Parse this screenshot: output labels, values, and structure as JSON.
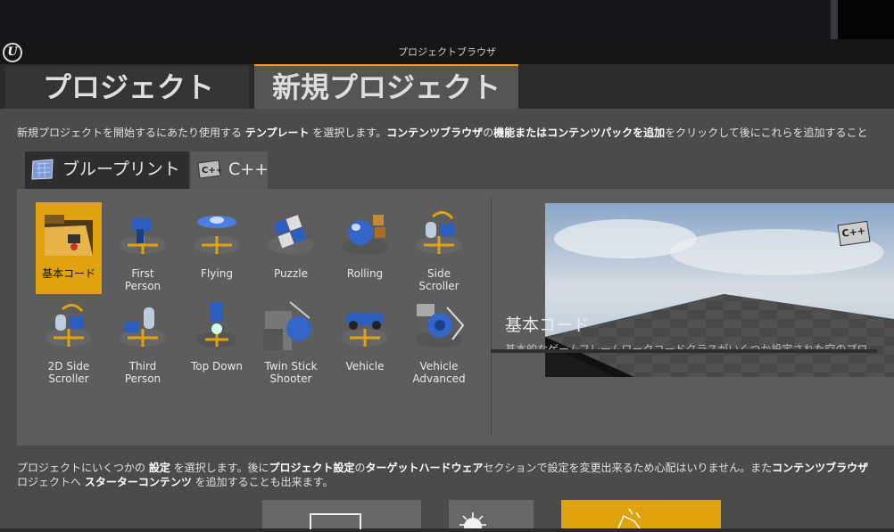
{
  "window": {
    "title": "プロジェクトブラウザ",
    "logo_text": "U"
  },
  "main_tabs": [
    {
      "label": "プロジェクト"
    },
    {
      "label": "新規プロジェクト"
    }
  ],
  "template_description": {
    "p1": "新規プロジェクトを開始するにあたり使用する ",
    "b1": "テンプレート",
    "p2": " を選択します。",
    "b2": "コンテンツブラウザ",
    "p3": "の",
    "b3": "機能またはコンテンツパックを追加",
    "p4": "をクリックして後にこれらを追加すること"
  },
  "sub_tabs": [
    {
      "label": "ブループリント",
      "icon": "blueprint-icon"
    },
    {
      "label": "C++",
      "icon": "cpp-icon"
    }
  ],
  "templates": [
    {
      "label": "基本コード",
      "selected": true,
      "icon": "folder-icon"
    },
    {
      "label": "First\nPerson",
      "icon": "first-person-icon"
    },
    {
      "label": "Flying",
      "icon": "flying-icon"
    },
    {
      "label": "Puzzle",
      "icon": "puzzle-icon"
    },
    {
      "label": "Rolling",
      "icon": "rolling-icon"
    },
    {
      "label": "Side\nScroller",
      "icon": "side-scroller-icon"
    },
    {
      "label": "2D Side\nScroller",
      "icon": "2d-side-scroller-icon"
    },
    {
      "label": "Third\nPerson",
      "icon": "third-person-icon"
    },
    {
      "label": "Top Down",
      "icon": "top-down-icon"
    },
    {
      "label": "Twin Stick\nShooter",
      "icon": "twin-stick-icon"
    },
    {
      "label": "Vehicle",
      "icon": "vehicle-icon"
    },
    {
      "label": "Vehicle\nAdvanced",
      "icon": "vehicle-advanced-icon"
    }
  ],
  "preview": {
    "badge": "C++",
    "title": "基本コード",
    "description": "基本的なゲームフレームワークコードクラスがいくつか設定された空のプロジェ"
  },
  "settings_description": {
    "line1_p1": "プロジェクトにいくつかの ",
    "line1_b1": "設定",
    "line1_p2": " を選択します。後に",
    "line1_b2": "プロジェクト設定",
    "line1_p3": "の",
    "line1_b3": "ターゲットハードウェア",
    "line1_p4": "セクションで設定を変更出来るため心配はいりません。また",
    "line1_b4": "コンテンツブラウザ",
    "line2_p1": "ロジェクトへ ",
    "line2_b1": "スターターコンテンツ",
    "line2_p2": " を追加することも出来ます。"
  },
  "colors": {
    "accent": "#e0a30d",
    "panel": "#5d5d5d",
    "background": "#4b4b4b"
  }
}
